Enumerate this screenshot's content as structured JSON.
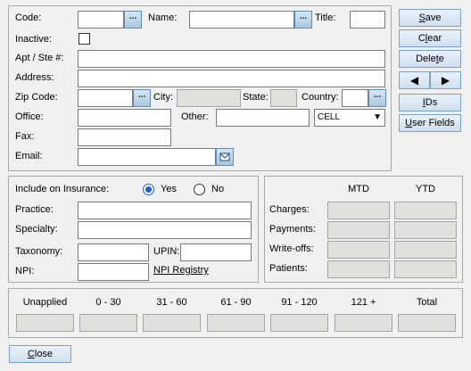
{
  "top_form": {
    "code_label": "Code:",
    "name_label": "Name:",
    "title_label": "Title:",
    "inactive_label": "Inactive:",
    "apt_label": "Apt / Ste #:",
    "address_label": "Address:",
    "zip_label": "Zip Code:",
    "city_label": "City:",
    "state_label": "State:",
    "country_label": "Country:",
    "office_label": "Office:",
    "other_label": "Other:",
    "phone_type": "CELL",
    "fax_label": "Fax:",
    "email_label": "Email:",
    "lookup_glyph": "...",
    "inactive_checked": false
  },
  "side_buttons": {
    "save_pre": "",
    "save_u": "S",
    "save_post": "ave",
    "clear_pre": "C",
    "clear_u": "l",
    "clear_post": "ear",
    "delete_pre": "Dele",
    "delete_u": "t",
    "delete_post": "e",
    "prev_glyph": "◀",
    "next_glyph": "▶",
    "ids_pre": "",
    "ids_u": "I",
    "ids_post": "Ds",
    "userfields_pre": "",
    "userfields_u": "U",
    "userfields_post": "ser Fields"
  },
  "insurance": {
    "include_label": "Include on Insurance:",
    "yes_label": "Yes",
    "no_label": "No",
    "selected": "Yes",
    "practice_label": "Practice:",
    "specialty_label": "Specialty:",
    "taxonomy_label": "Taxonomy:",
    "upin_label": "UPIN:",
    "npi_label": "NPI:",
    "npi_registry_link": "NPI Registry"
  },
  "stats": {
    "mtd_label": "MTD",
    "ytd_label": "YTD",
    "rows": [
      "Charges:",
      "Payments:",
      "Write-offs:",
      "Patients:"
    ]
  },
  "aging": {
    "headers": [
      "Unapplied",
      "0 - 30",
      "31 - 60",
      "61 - 90",
      "91 - 120",
      "121 +",
      "Total"
    ]
  },
  "close_button": {
    "pre": "",
    "u": "C",
    "post": "lose"
  },
  "icons": {
    "email_icon": "envelope-icon"
  },
  "colors": {
    "button_border": "#7da2c4",
    "readonly_fill": "#e1e0dc",
    "radio_accent": "#1f5fc7"
  }
}
